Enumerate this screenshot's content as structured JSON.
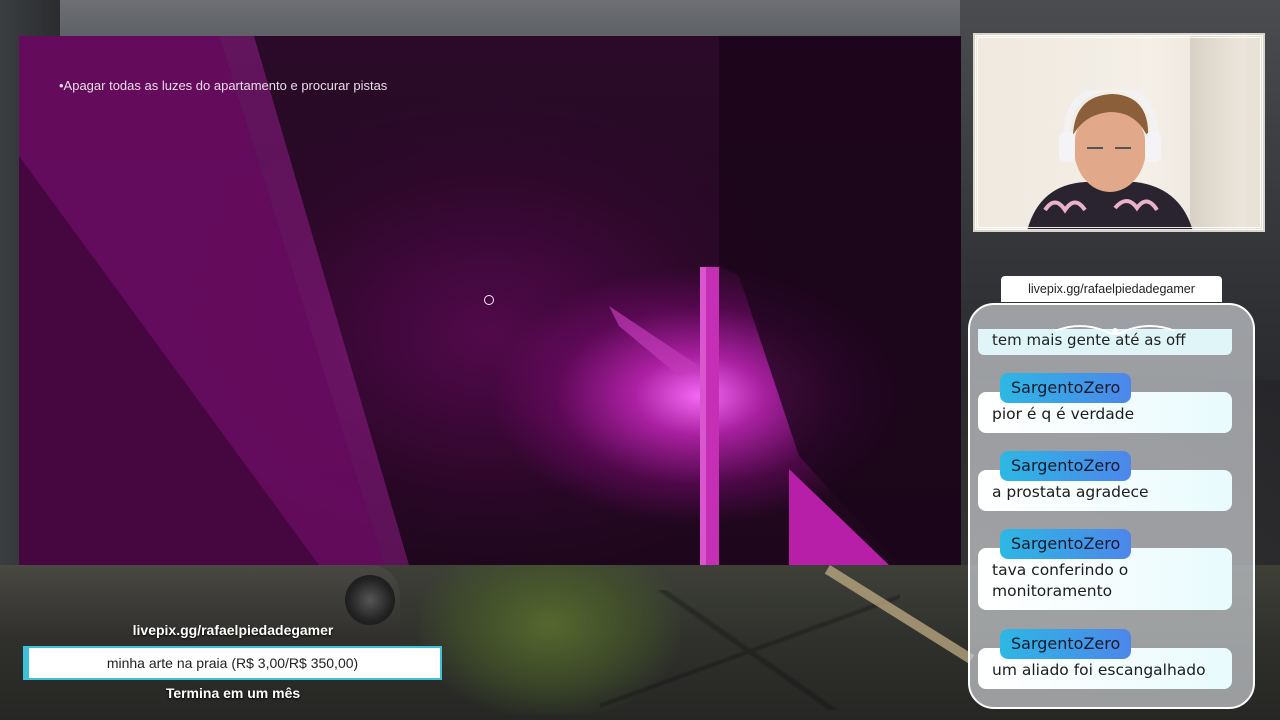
{
  "game": {
    "subtitle": "•Apagar todas as luzes do apartamento e procurar pistas"
  },
  "chat": {
    "source_url": "livepix.gg/rafaelpiedadegamer",
    "partial_message": "tem mais gente até as off",
    "messages": [
      {
        "user": "SargentoZero",
        "text": "pior é q é verdade"
      },
      {
        "user": "SargentoZero",
        "text": "a prostata agradece"
      },
      {
        "user": "SargentoZero",
        "text": "tava conferindo o monitoramento"
      },
      {
        "user": "SargentoZero",
        "text": "um aliado foi escangalhado"
      }
    ]
  },
  "goal": {
    "url": "livepix.gg/rafaelpiedadegamer",
    "label": "minha arte na praia (R$ 3,00/R$ 350,00)",
    "progress_fraction": 0.0086,
    "ends": "Termina em um mês"
  },
  "colors": {
    "accent": "#3fc0da",
    "user_badge_start": "#2db7e4",
    "user_badge_end": "#4d86ea",
    "game_glow": "#ff6eff"
  }
}
